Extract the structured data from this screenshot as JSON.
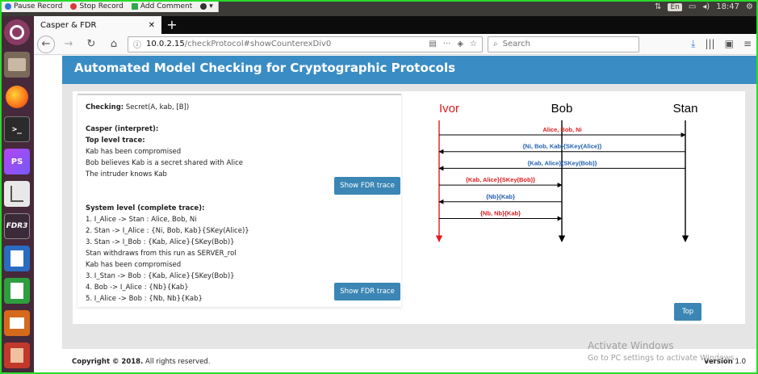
{
  "recorder": {
    "pause_label": "Pause Record",
    "stop_label": "Stop Record",
    "comment_label": "Add Comment",
    "colors": {
      "pause": "#3a6fd8",
      "stop": "#d83a3a",
      "comment": "#2ea84a",
      "help": "#333333"
    }
  },
  "system_tray": {
    "keyboard_layout": "En",
    "time": "18:47"
  },
  "launcher": {
    "items": [
      {
        "name": "ubuntu-dash-icon",
        "label": ""
      },
      {
        "name": "files-icon",
        "label": ""
      },
      {
        "name": "firefox-icon",
        "label": ""
      },
      {
        "name": "terminal-icon",
        "label": ">_"
      },
      {
        "name": "phpstorm-icon",
        "label": "PS"
      },
      {
        "name": "text-editor-icon",
        "label": ""
      },
      {
        "name": "fdr3-icon",
        "label": "FDR3"
      },
      {
        "name": "writer-icon",
        "label": ""
      },
      {
        "name": "calc-icon",
        "label": ""
      },
      {
        "name": "impress-icon",
        "label": ""
      },
      {
        "name": "trash-icon",
        "label": ""
      }
    ]
  },
  "browser": {
    "tab_title": "Casper & FDR",
    "url_host": "10.0.2.15",
    "url_path": "/checkProtocol#showCounterexDiv0",
    "search_placeholder": "Search"
  },
  "page": {
    "header_title": "Automated Model Checking for Cryptographic Protocols",
    "checking_label": "Checking:",
    "checking_value": " Secret(A, kab, [B])",
    "casper_heading": "Casper (interpret):",
    "top_level_heading": "Top level trace:",
    "top_level_lines": [
      "Kab has been compromised",
      "Bob believes Kab is a secret shared with Alice",
      "The intruder knows Kab"
    ],
    "show_fdr_label_1": "Show FDR trace",
    "system_level_heading": "System level (complete trace):",
    "system_level_lines": [
      "1. I_Alice -> Stan : Alice, Bob, Ni",
      "2. Stan -> I_Alice : {Ni, Bob, Kab}{SKey(Alice)}",
      "3. Stan -> I_Bob : {Kab, Alice}{SKey(Bob)}",
      "Stan withdraws from this run as SERVER_rol",
      "Kab has been compromised",
      "3. I_Stan -> Bob : {Kab, Alice}{SKey(Bob)}",
      "4. Bob -> I_Alice : {Nb}{Kab}",
      "5. I_Alice -> Bob : {Nb, Nb}{Kab}"
    ],
    "show_fdr_label_2": "Show FDR trace",
    "top_button_label": "Top",
    "footer_copyright": "Copyright © 2018.",
    "footer_rights": " All rights reserved.",
    "footer_version_label": "Version",
    "footer_version_value": " 1.0"
  },
  "sequence_diagram": {
    "participants": [
      {
        "name": "Ivor",
        "color": "#e01b1b"
      },
      {
        "name": "Bob",
        "color": "#000000"
      },
      {
        "name": "Stan",
        "color": "#000000"
      }
    ],
    "messages": [
      {
        "from": "Ivor",
        "to": "Stan",
        "label": "Alice, Bob, Ni",
        "color": "#e01b1b"
      },
      {
        "from": "Stan",
        "to": "Ivor",
        "label": "{Ni, Bob, Kab}{SKey(Alice)}",
        "color": "#2060b0"
      },
      {
        "from": "Stan",
        "to": "Ivor",
        "label": "{Kab, Alice}{SKey(Bob)}",
        "color": "#2060b0"
      },
      {
        "from": "Ivor",
        "to": "Bob",
        "label": "{Kab, Alice}{SKey(Bob)}",
        "color": "#e01b1b"
      },
      {
        "from": "Bob",
        "to": "Ivor",
        "label": "{Nb}{Kab}",
        "color": "#2060b0"
      },
      {
        "from": "Ivor",
        "to": "Bob",
        "label": "{Nb, Nb}{Kab}",
        "color": "#e01b1b"
      }
    ]
  },
  "watermark": {
    "title": "Activate Windows",
    "subtitle": "Go to PC settings to activate Windows."
  }
}
